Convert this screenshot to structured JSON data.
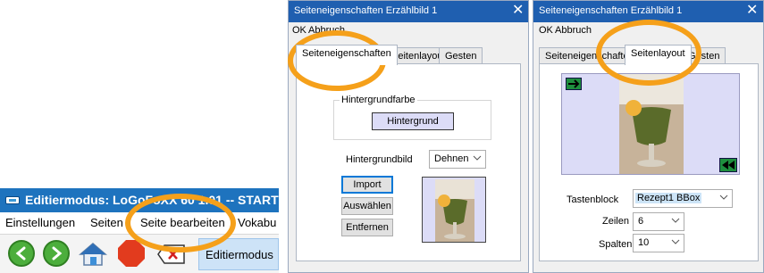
{
  "editor": {
    "title": "Editiermodus: LoGoFoXX 60 1.01 -- START",
    "menu": [
      "Einstellungen",
      "Seiten",
      "Seite bearbeiten",
      "Vokabu"
    ],
    "mode_label": "Editiermodus",
    "icons": [
      "back-arrow-icon",
      "forward-arrow-icon",
      "home-icon",
      "stop-icon",
      "delete-icon"
    ]
  },
  "dialog1": {
    "title": "Seiteneigenschaften Erzählbild 1",
    "close": "✕",
    "menu": {
      "ok": "OK",
      "cancel": "Abbruch"
    },
    "tabs": [
      "Seiteneigenschaften",
      "Seitenlayout",
      "Gesten"
    ],
    "bg_color_group": "Hintergrundfarbe",
    "bg_color_button": "Hintergrund",
    "bg_image_label": "Hintergrundbild",
    "stretch_value": "Dehnen",
    "import_button": "Import",
    "select_button": "Auswählen",
    "remove_button": "Entfernen"
  },
  "dialog2": {
    "title": "Seiteneigenschaften Erzählbild 1",
    "close": "✕",
    "menu": {
      "ok": "OK",
      "cancel": "Abbruch"
    },
    "tabs": [
      "Seiteneigenschaften",
      "Seitenlayout",
      "Gesten"
    ],
    "key_block_label": "Tastenblock",
    "key_block_value": "Rezept1 BBox",
    "rows_label": "Zeilen",
    "rows_value": "6",
    "cols_label": "Spalten",
    "cols_value": "10"
  },
  "colors": {
    "highlight_ring": "#f5a01a",
    "title_bar": "#1f5fb0",
    "preview_bg": "#dcdcf7"
  }
}
